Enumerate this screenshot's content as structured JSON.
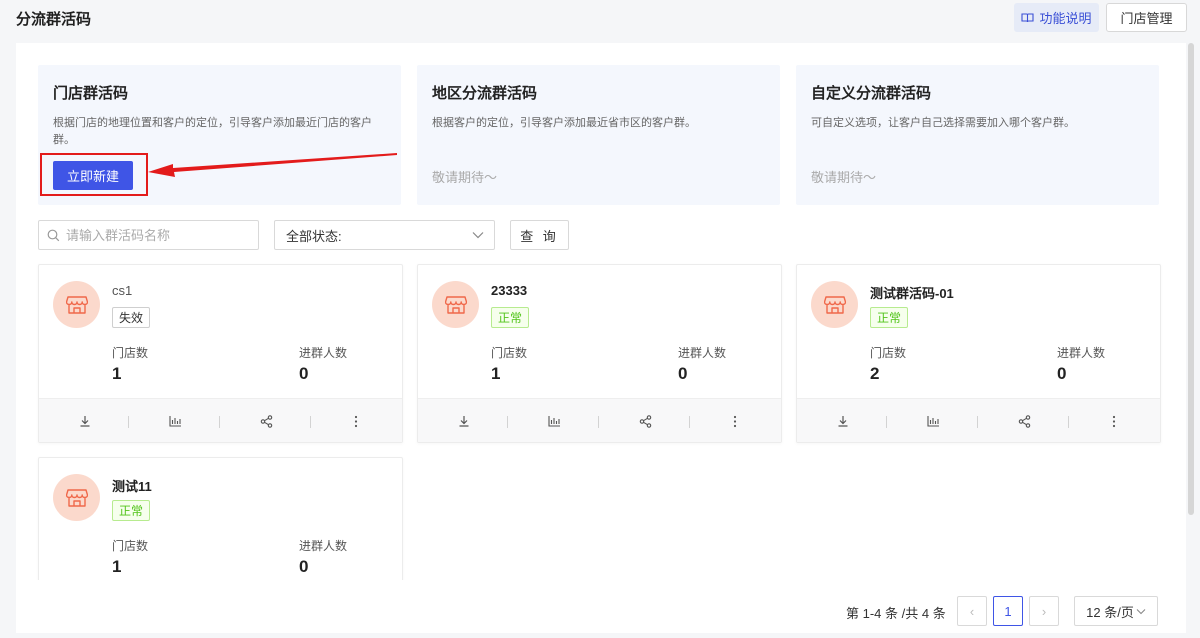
{
  "header": {
    "title": "分流群活码",
    "help_label": "功能说明",
    "store_label": "门店管理"
  },
  "types": [
    {
      "title": "门店群活码",
      "desc": "根据门店的地理位置和客户的定位，引导客户添加最近门店的客户群。",
      "action": "立即新建"
    },
    {
      "title": "地区分流群活码",
      "desc": "根据客户的定位，引导客户添加最近省市区的客户群。",
      "soon": "敬请期待～"
    },
    {
      "title": "自定义分流群活码",
      "desc": "可自定义选项，让客户自己选择需要加入哪个客户群。",
      "soon": "敬请期待～"
    }
  ],
  "filters": {
    "search_placeholder": "请输入群活码名称",
    "status_label": "全部状态:",
    "query_label": "查 询"
  },
  "stat_labels": {
    "stores": "门店数",
    "members": "进群人数"
  },
  "cards": [
    {
      "name": "cs1",
      "status": "失效",
      "stores": "1",
      "members": "0"
    },
    {
      "name": "23333",
      "status": "正常",
      "stores": "1",
      "members": "0"
    },
    {
      "name": "测试群活码-01",
      "status": "正常",
      "stores": "2",
      "members": "0"
    },
    {
      "name": "测试11",
      "status": "正常",
      "stores": "1",
      "members": "0"
    }
  ],
  "pagination": {
    "total_text": "第 1-4 条 /共 4 条",
    "current_page": "1",
    "page_size": "12 条/页",
    "prev": "‹",
    "next": "›"
  },
  "colors": {
    "primary": "#3f55e6",
    "normal": "#52c41a",
    "highlight": "#e31b1b",
    "avatar_bg": "#fbd9cc"
  }
}
